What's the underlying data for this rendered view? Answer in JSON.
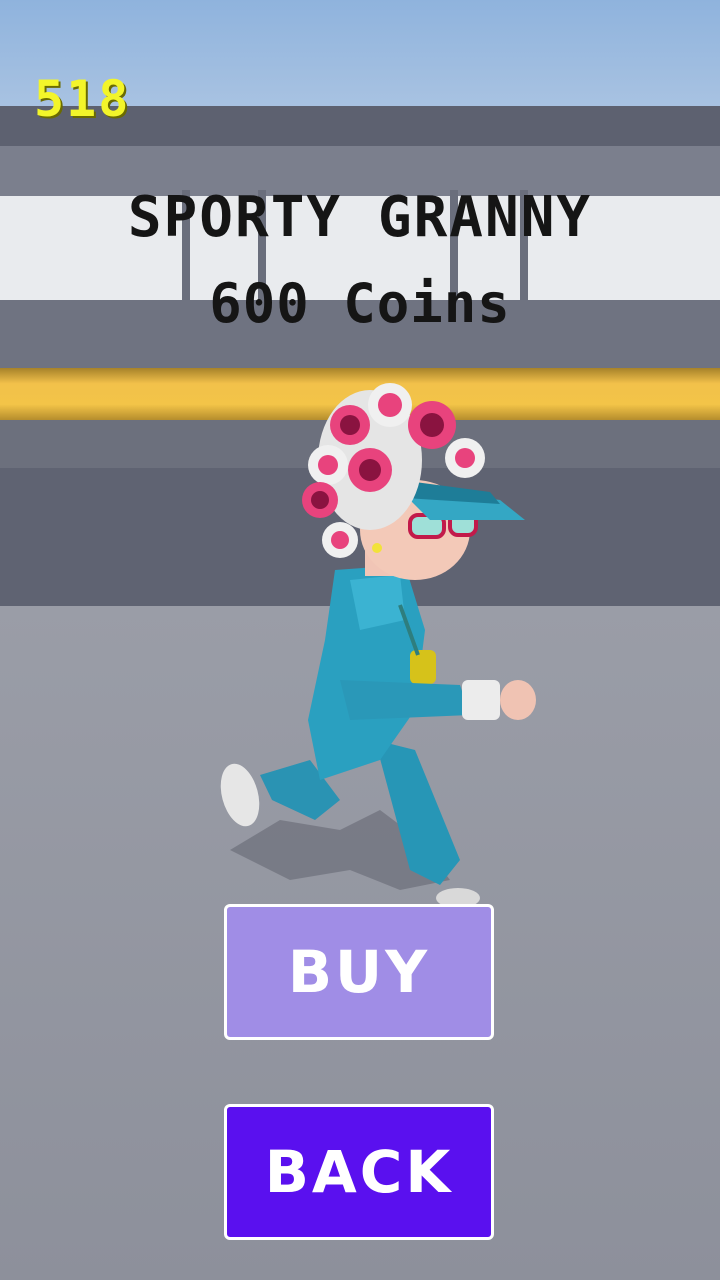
{
  "hud": {
    "coin_count": "518"
  },
  "shop": {
    "character_name": "SPORTY GRANNY",
    "price": "600 Coins"
  },
  "buttons": {
    "buy_label": "BUY",
    "back_label": "BACK"
  },
  "colors": {
    "coin_count": "#f3f52a",
    "buy_button": "#a08de6",
    "back_button": "#5a10ef",
    "stripe": "#f2c14a"
  }
}
